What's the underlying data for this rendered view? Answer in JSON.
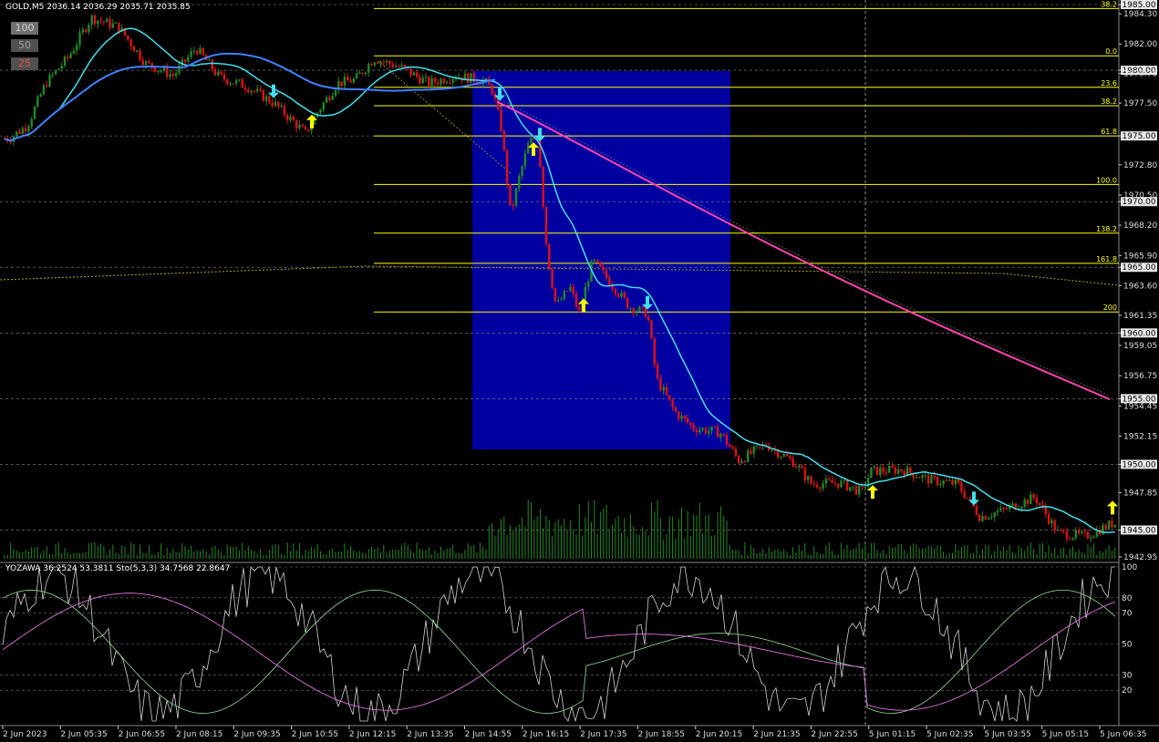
{
  "header": {
    "symbol_info": "GOLD,M5  2036.14 2036.29 2035.71 2035.85",
    "indicator_info": "YOZAWA 36.2524 53.3811  Sto(5,3,3) 34.7568 22.8647"
  },
  "buttons": [
    "100",
    "50",
    "25"
  ],
  "chart_data": {
    "type": "candlestick",
    "price_axis": {
      "ylim": [
        1942.95,
        1985.0
      ],
      "ticks": [
        "1985.00",
        "1984.30",
        "1982.00",
        "1980.00",
        "1979.75",
        "1977.50",
        "1975.00",
        "1972.80",
        "1970.50",
        "1970.00",
        "1968.20",
        "1965.90",
        "1965.00",
        "1963.60",
        "1961.35",
        "1960.00",
        "1959.05",
        "1956.75",
        "1955.00",
        "1954.45",
        "1952.15",
        "1950.00",
        "1947.85",
        "1945.00",
        "1942.95"
      ],
      "highlighted": [
        "1985.00",
        "1980.00",
        "1975.00",
        "1970.00",
        "1965.00",
        "1960.00",
        "1955.00",
        "1950.00",
        "1945.00"
      ]
    },
    "time_axis": [
      "2 Jun 2023",
      "2 Jun 05:35",
      "2 Jun 06:55",
      "2 Jun 08:15",
      "2 Jun 09:35",
      "2 Jun 10:55",
      "2 Jun 12:15",
      "2 Jun 13:35",
      "2 Jun 14:55",
      "2 Jun 16:15",
      "2 Jun 17:35",
      "2 Jun 18:55",
      "2 Jun 20:15",
      "2 Jun 21:35",
      "2 Jun 22:55",
      "5 Jun 01:15",
      "5 Jun 02:35",
      "5 Jun 03:55",
      "5 Jun 05:15",
      "5 Jun 06:35"
    ],
    "fibonacci": [
      {
        "label": "38.2",
        "price": 1984.7
      },
      {
        "label": "0.0",
        "price": 1981.1
      },
      {
        "label": "23.6",
        "price": 1978.7
      },
      {
        "label": "38.2",
        "price": 1977.3
      },
      {
        "label": "61.8",
        "price": 1975.0
      },
      {
        "label": "100.0",
        "price": 1971.3
      },
      {
        "label": "138.2",
        "price": 1967.6
      },
      {
        "label": "161.8",
        "price": 1965.3
      },
      {
        "label": "200",
        "price": 1961.6
      }
    ],
    "price_path": [
      {
        "x": 10,
        "p": 1974.8
      },
      {
        "x": 30,
        "p": 1975.8
      },
      {
        "x": 50,
        "p": 1979.0
      },
      {
        "x": 75,
        "p": 1981.0
      },
      {
        "x": 100,
        "p": 1984.0
      },
      {
        "x": 130,
        "p": 1983.3
      },
      {
        "x": 160,
        "p": 1980.5
      },
      {
        "x": 190,
        "p": 1979.6
      },
      {
        "x": 215,
        "p": 1981.7
      },
      {
        "x": 240,
        "p": 1979.5
      },
      {
        "x": 270,
        "p": 1978.8
      },
      {
        "x": 300,
        "p": 1977.5
      },
      {
        "x": 320,
        "p": 1976.2
      },
      {
        "x": 335,
        "p": 1975.2
      },
      {
        "x": 350,
        "p": 1977.0
      },
      {
        "x": 370,
        "p": 1979.0
      },
      {
        "x": 390,
        "p": 1979.3
      },
      {
        "x": 410,
        "p": 1980.9
      },
      {
        "x": 440,
        "p": 1980.2
      },
      {
        "x": 470,
        "p": 1979.0
      },
      {
        "x": 500,
        "p": 1979.6
      },
      {
        "x": 530,
        "p": 1979.2
      },
      {
        "x": 540,
        "p": 1978.5
      },
      {
        "x": 550,
        "p": 1975.5
      },
      {
        "x": 560,
        "p": 1969.0
      },
      {
        "x": 570,
        "p": 1972.0
      },
      {
        "x": 580,
        "p": 1974.5
      },
      {
        "x": 590,
        "p": 1975.0
      },
      {
        "x": 600,
        "p": 1966.0
      },
      {
        "x": 610,
        "p": 1962.0
      },
      {
        "x": 625,
        "p": 1963.5
      },
      {
        "x": 635,
        "p": 1961.5
      },
      {
        "x": 650,
        "p": 1965.5
      },
      {
        "x": 670,
        "p": 1963.8
      },
      {
        "x": 690,
        "p": 1962.0
      },
      {
        "x": 710,
        "p": 1961.5
      },
      {
        "x": 720,
        "p": 1956.5
      },
      {
        "x": 740,
        "p": 1954.0
      },
      {
        "x": 760,
        "p": 1952.8
      },
      {
        "x": 790,
        "p": 1952.4
      },
      {
        "x": 810,
        "p": 1950.3
      },
      {
        "x": 840,
        "p": 1951.5
      },
      {
        "x": 870,
        "p": 1950.2
      },
      {
        "x": 890,
        "p": 1948.5
      },
      {
        "x": 920,
        "p": 1948.6
      },
      {
        "x": 945,
        "p": 1947.9
      },
      {
        "x": 955,
        "p": 1949.5
      },
      {
        "x": 990,
        "p": 1949.6
      },
      {
        "x": 1020,
        "p": 1948.8
      },
      {
        "x": 1050,
        "p": 1948.5
      },
      {
        "x": 1075,
        "p": 1946.0
      },
      {
        "x": 1100,
        "p": 1946.5
      },
      {
        "x": 1135,
        "p": 1947.5
      },
      {
        "x": 1160,
        "p": 1944.8
      },
      {
        "x": 1190,
        "p": 1944.5
      },
      {
        "x": 1220,
        "p": 1945.5
      }
    ],
    "ma_fast_color": "#40e0f0",
    "ma_slow_color": "#4080ff",
    "ma_long_color": "#ff40b0",
    "bull_color": "#1f8a1f",
    "bear_color": "#e01010",
    "range_box_color": "#0000a0",
    "oscillator": {
      "ylim": [
        0,
        100
      ],
      "levels": [
        "100",
        "80",
        "70",
        "50",
        "30",
        "20"
      ]
    },
    "arrows": [
      {
        "x": 300,
        "p": 1978.5,
        "dir": "down"
      },
      {
        "x": 342,
        "p": 1976.0,
        "dir": "up"
      },
      {
        "x": 548,
        "p": 1978.3,
        "dir": "down"
      },
      {
        "x": 585,
        "p": 1973.9,
        "dir": "up"
      },
      {
        "x": 592,
        "p": 1975.2,
        "dir": "down"
      },
      {
        "x": 640,
        "p": 1962.0,
        "dir": "up"
      },
      {
        "x": 710,
        "p": 1962.4,
        "dir": "down"
      },
      {
        "x": 957,
        "p": 1947.8,
        "dir": "up"
      },
      {
        "x": 1068,
        "p": 1947.5,
        "dir": "down"
      },
      {
        "x": 1220,
        "p": 1946.6,
        "dir": "up"
      }
    ]
  }
}
